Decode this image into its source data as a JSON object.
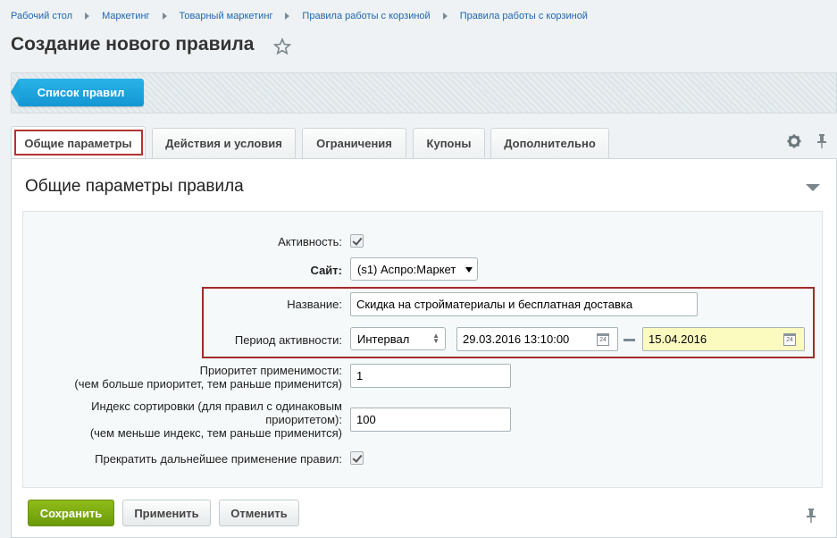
{
  "breadcrumb": [
    "Рабочий стол",
    "Маркетинг",
    "Товарный маркетинг",
    "Правила работы с корзиной",
    "Правила работы с корзиной"
  ],
  "page": {
    "title": "Создание нового правила"
  },
  "toolbar": {
    "list_button": "Список правил"
  },
  "tabs": [
    {
      "label": "Общие параметры"
    },
    {
      "label": "Действия и условия"
    },
    {
      "label": "Ограничения"
    },
    {
      "label": "Купоны"
    },
    {
      "label": "Дополнительно"
    }
  ],
  "section": {
    "title": "Общие параметры правила"
  },
  "form": {
    "active_label": "Активность:",
    "site_label": "Сайт:",
    "site_value": "(s1) Аспро:Маркет",
    "name_label": "Название:",
    "name_value": "Скидка на стройматериалы и бесплатная доставка",
    "period_label": "Период активности:",
    "period_type": "Интервал",
    "period_from": "29.03.2016 13:10:00",
    "period_to": "15.04.2016",
    "priority_label_1": "Приоритет применимости:",
    "priority_label_2": "(чем больше приоритет, тем раньше применится)",
    "priority_value": "1",
    "sort_label_1": "Индекс сортировки (для правил с одинаковым",
    "sort_label_2": "приоритетом):",
    "sort_label_3": "(чем меньше индекс, тем раньше применится)",
    "sort_value": "100",
    "stop_label": "Прекратить дальнейшее применение правил:"
  },
  "buttons": {
    "save": "Сохранить",
    "apply": "Применить",
    "cancel": "Отменить"
  },
  "calendar_icon_text": "24",
  "colors": {
    "accent_blue": "#1496d3",
    "save_green": "#7aa80f",
    "highlight_red": "#a52a2a",
    "date_to_bg": "#fbfbc0"
  }
}
